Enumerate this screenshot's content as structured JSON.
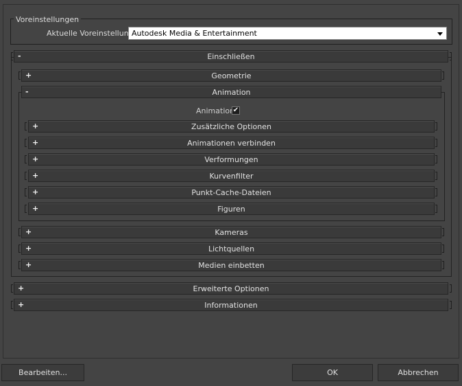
{
  "preset_group": {
    "legend": "Voreinstellungen",
    "label": "Aktuelle Voreinstellung:",
    "selected": "Autodesk Media & Entertainment"
  },
  "rollouts": {
    "einschliessen": {
      "label": "Einschließen",
      "sign": "-"
    },
    "geometrie": {
      "label": "Geometrie",
      "sign": "+"
    },
    "animation": {
      "label": "Animation",
      "sign": "-"
    },
    "animation_checkbox_label": "Animation",
    "animation_checked": true,
    "zusatzliche": {
      "label": "Zusätzliche Optionen",
      "sign": "+"
    },
    "verbinden": {
      "label": "Animationen verbinden",
      "sign": "+"
    },
    "verformungen": {
      "label": "Verformungen",
      "sign": "+"
    },
    "kurvenfilter": {
      "label": "Kurvenfilter",
      "sign": "+"
    },
    "punktcache": {
      "label": "Punkt-Cache-Dateien",
      "sign": "+"
    },
    "figuren": {
      "label": "Figuren",
      "sign": "+"
    },
    "kameras": {
      "label": "Kameras",
      "sign": "+"
    },
    "lichtquellen": {
      "label": "Lichtquellen",
      "sign": "+"
    },
    "medien": {
      "label": "Medien einbetten",
      "sign": "+"
    },
    "erweiterte": {
      "label": "Erweiterte Optionen",
      "sign": "+"
    },
    "informationen": {
      "label": "Informationen",
      "sign": "+"
    }
  },
  "buttons": {
    "edit": "Bearbeiten...",
    "ok": "OK",
    "cancel": "Abbrechen"
  }
}
